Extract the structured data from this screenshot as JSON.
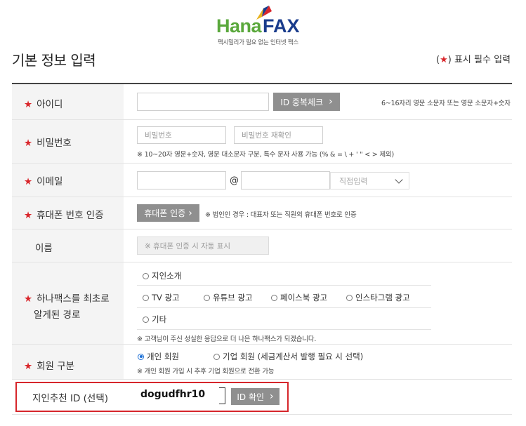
{
  "logo": {
    "brand_a": "Hana",
    "brand_b": "FAX",
    "slogan": "팩시밀리가 필요 없는 인터넷 팩스"
  },
  "page": {
    "title": "기본 정보 입력",
    "required_open": "(",
    "required_star": "★",
    "required_close": ") 표시 필수 입력"
  },
  "star": "★",
  "fields": {
    "id": {
      "label": "아이디",
      "check_button": "ID 중복체크",
      "hint": "6~16자리 영문 소문자 또는 영문 소문자+숫자"
    },
    "password": {
      "label": "비밀번호",
      "placeholder": "비밀번호",
      "confirm_placeholder": "비밀번호 재확인",
      "hint": "※ 10~20자 영문+숫자, 영문 대소문자 구분, 특수 문자 사용 가능 (% & = \\ + ' \" < > 제외)"
    },
    "email": {
      "label": "이메일",
      "at": "@",
      "domain_select": "직접입력"
    },
    "phone": {
      "label": "휴대폰 번호 인증",
      "button": "휴대폰 인증",
      "hint": "※ 법인인 경우 : 대표자 또는 직원의 휴대폰 번호로 인증"
    },
    "name": {
      "label": "이름",
      "placeholder": "※ 휴대폰 인증 시 자동 표시"
    },
    "source": {
      "label_line1": "하나팩스를 최초로",
      "label_line2": "알게된 경로",
      "options": [
        "지인소개",
        "TV 광고",
        "유튜브 광고",
        "페이스북 광고",
        "인스타그램 광고",
        "기타"
      ],
      "hint": "※ 고객님이 주신 성실한 응답으로 더 나은 하나팩스가 되겠습니다."
    },
    "member_type": {
      "label": "회원 구분",
      "options": [
        "개인 회원",
        "기업 회원 (세금계산서 발행 필요 시 선택)"
      ],
      "selected": "개인 회원",
      "hint": "※ 개인 회원 가입 시 추후 기업 회원으로 전환 가능"
    },
    "recommend": {
      "label": "지인추천 ID (선택)",
      "value": "dogudfhr10",
      "button": "ID 확인"
    }
  },
  "colors": {
    "accent_red": "#d9262b",
    "button_gray": "#8f8f8f",
    "label_bg": "#f4f4f4",
    "radio_blue": "#1c6fd6"
  }
}
